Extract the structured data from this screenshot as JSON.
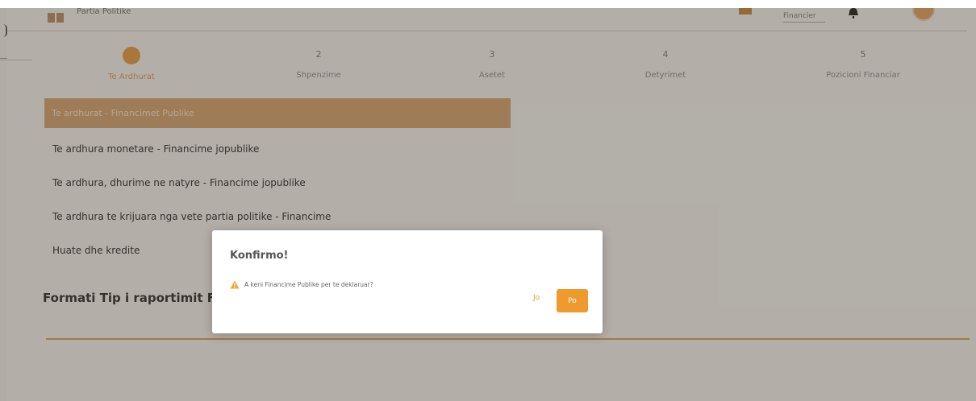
{
  "header": {
    "brand": "Partia Politike",
    "select_value": "Financier"
  },
  "stepper": [
    {
      "num": "",
      "label": "Te Ardhurat",
      "active": true
    },
    {
      "num": "2",
      "label": "Shpenzime",
      "active": false
    },
    {
      "num": "3",
      "label": "Asetet",
      "active": false
    },
    {
      "num": "4",
      "label": "Detyrimet",
      "active": false
    },
    {
      "num": "5",
      "label": "Pozicioni Financiar",
      "active": false
    }
  ],
  "list": {
    "active_item": "Te ardhurat - Financimet Publike",
    "items": [
      "Te ardhura monetare - Financime jopublike",
      "Te ardhura, dhurime ne natyre - Financime jopublike",
      "Te ardhura te krijuara nga vete partia politike - Financime",
      "Huate dhe kredite"
    ]
  },
  "section_title": "Formati Tip i raportimit Fi",
  "dialog": {
    "title": "Konfirmo!",
    "message": "A keni Financime Publike per te deklaruar?",
    "no_label": "Jo",
    "yes_label": "Po"
  },
  "colors": {
    "accent": "#ef9a2e",
    "active_bar": "#d8a36b",
    "overlay": "rgba(80,72,62,0.42)"
  }
}
